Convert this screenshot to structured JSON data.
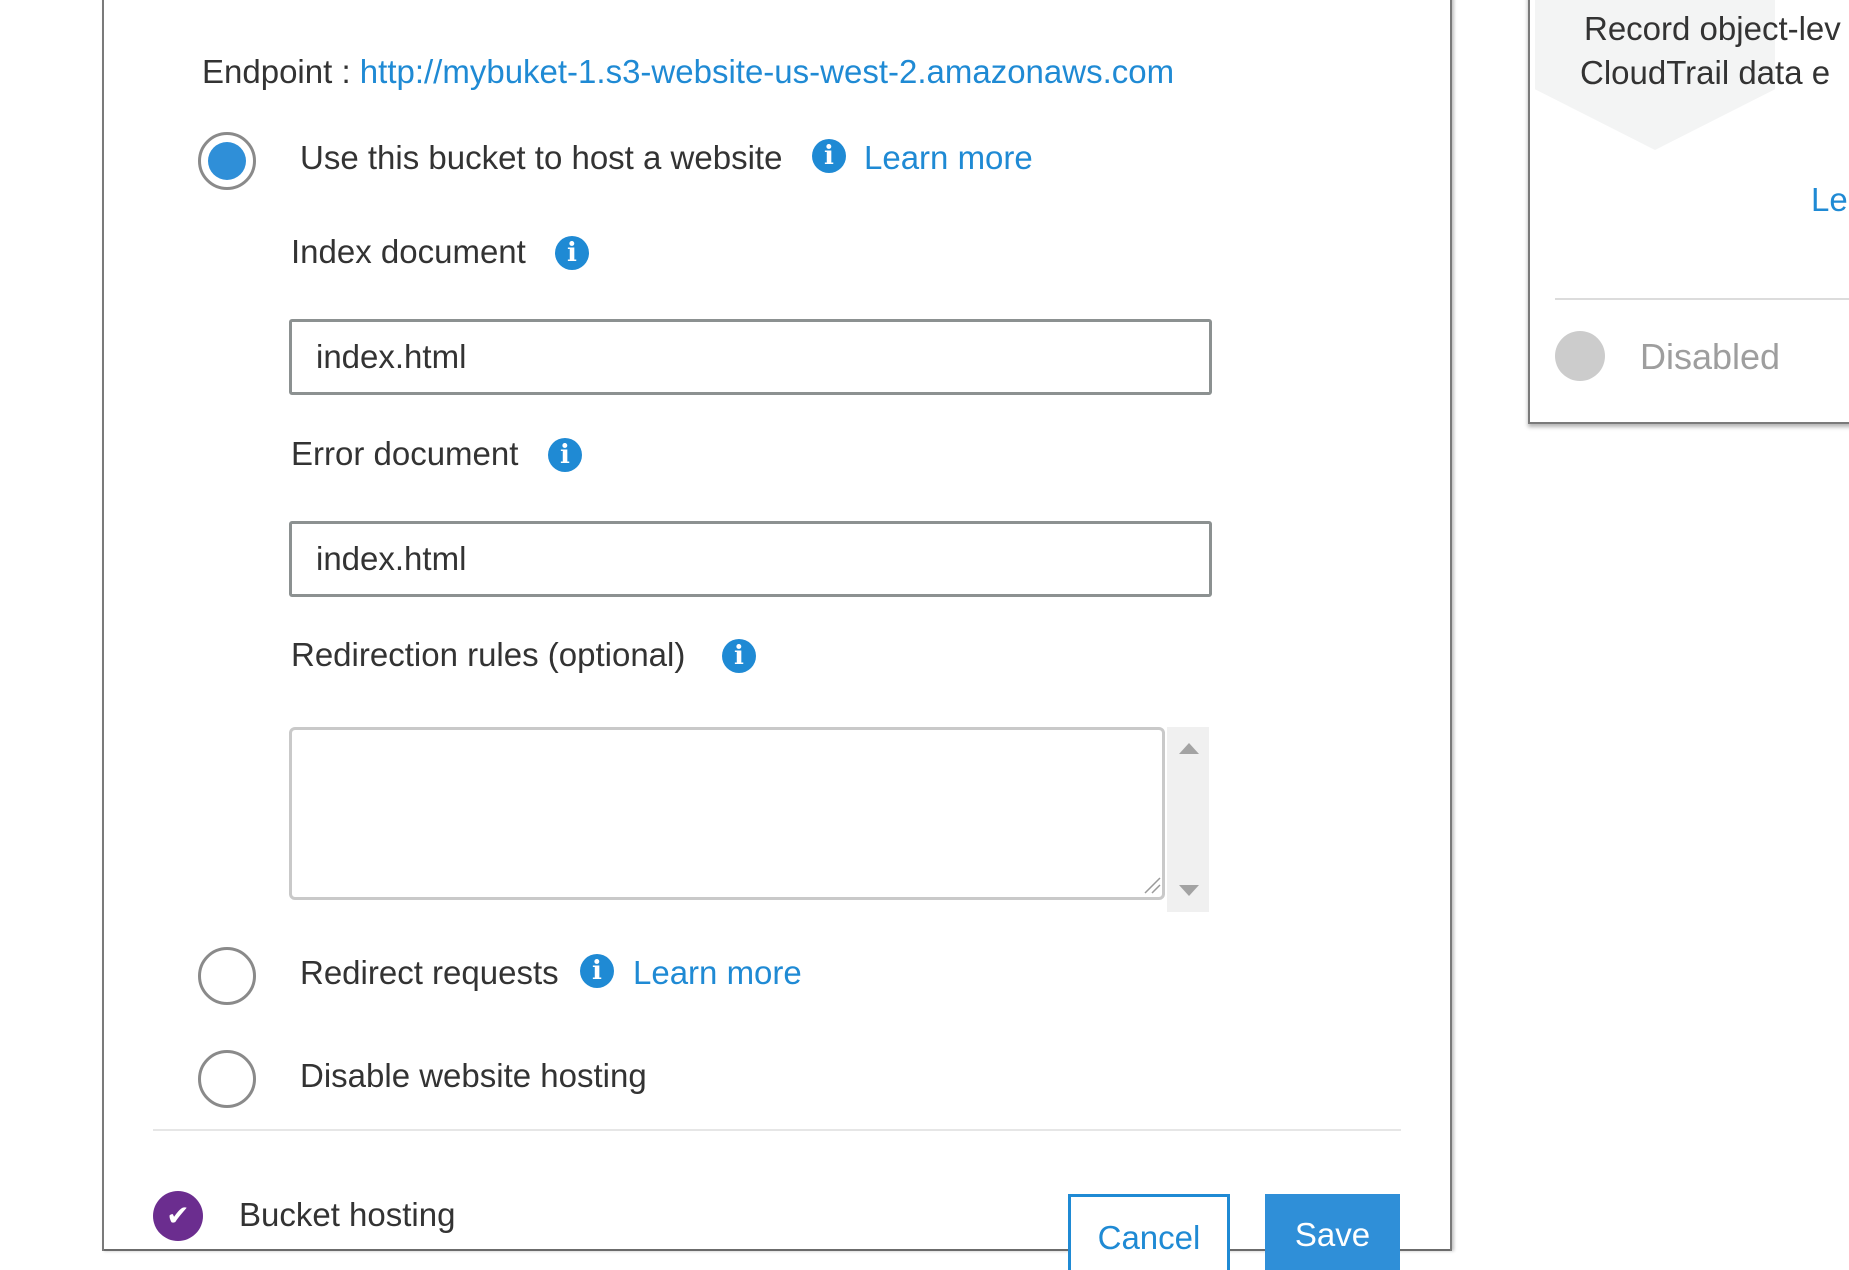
{
  "website_hosting": {
    "endpoint_label": "Endpoint :",
    "endpoint_url": "http://mybuket-1.s3-website-us-west-2.amazonaws.com",
    "options": {
      "host": {
        "label": "Use this bucket to host a website",
        "learn_more": "Learn more",
        "selected": true
      },
      "redirect": {
        "label": "Redirect requests",
        "learn_more": "Learn more",
        "selected": false
      },
      "disable": {
        "label": "Disable website hosting",
        "selected": false
      }
    },
    "index_document": {
      "label": "Index document",
      "value": "index.html"
    },
    "error_document": {
      "label": "Error document",
      "value": "index.html"
    },
    "redirection_rules": {
      "label": "Redirection rules (optional)",
      "value": ""
    },
    "footer": {
      "status_label": "Bucket hosting",
      "cancel": "Cancel",
      "save": "Save"
    }
  },
  "side_card": {
    "description_line1": "Record object-lev",
    "description_line2": "CloudTrail data e",
    "learn_more_fragment": "Le",
    "status": "Disabled"
  },
  "icons": {
    "info": "info-icon",
    "check": "check-icon"
  },
  "colors": {
    "link": "#1f8ad4",
    "radio_selected": "#2f8fd8",
    "success_badge": "#6b2d8f",
    "primary_button": "#2f8fd8"
  }
}
